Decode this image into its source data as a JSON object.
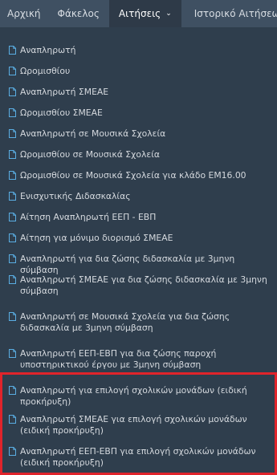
{
  "nav": {
    "home": "Αρχική",
    "folder": "Φάκελος",
    "applications": "Αιτήσεις",
    "history": "Ιστορικό Αιτήσεων"
  },
  "menu": [
    "Αναπληρωτή",
    "Ωρομισθίου",
    "Αναπληρωτή ΣΜΕΑΕ",
    "Ωρομισθίου ΣΜΕΑΕ",
    "Αναπληρωτή σε Μουσικά Σχολεία",
    "Ωρομισθίου σε Μουσικά Σχολεία",
    "Ωρομισθίου σε Μουσικά Σχολεία για κλάδο ΕΜ16.00",
    "Ενισχυτικής Διδασκαλίας",
    "Αίτηση Αναπληρωτή ΕΕΠ - ΕΒΠ",
    "Αίτηση για μόνιμο διορισμό ΣΜΕΑΕ",
    "Αναπληρωτή για δια ζώσης διδασκαλία με 3μηνη σύμβαση",
    "Αναπληρωτή ΣΜΕΑΕ για δια ζώσης διδασκαλία με 3μηνη σύμβαση",
    "Αναπληρωτή σε Μουσικά Σχολεία για δια ζώσης διδασκαλία με 3μηνη σύμβαση",
    "Αναπληρωτή ΕΕΠ-ΕΒΠ για δια ζώσης παροχή υποστηρικτικού έργου με 3μηνη σύμβαση",
    "Αναπληρωτή για επιλογή σχολικών μονάδων (ειδική προκήρυξη)",
    "Αναπληρωτή ΣΜΕΑΕ για επιλογή σχολικών μονάδων (ειδική προκήρυξη)",
    "Αναπληρωτή ΕΕΠ-ΕΒΠ για επιλογή σχολικών μονάδων (ειδική προκήρυξη)"
  ],
  "colors": {
    "nav_bg": "#3f5062",
    "menu_bg": "#2f3e4d",
    "icon": "#5aaee3",
    "highlight_border": "#e0242b"
  }
}
